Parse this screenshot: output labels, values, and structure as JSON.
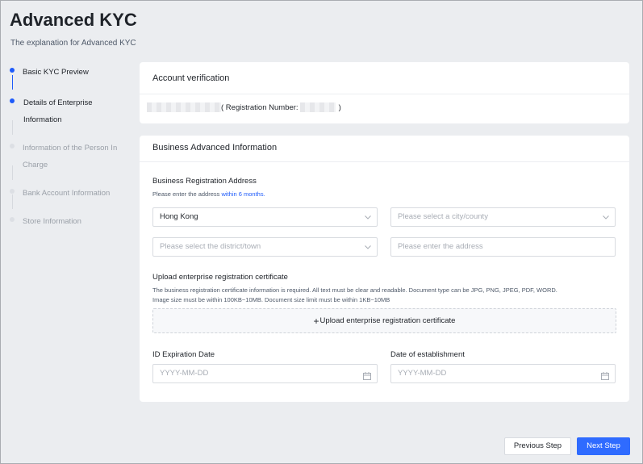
{
  "page": {
    "title": "Advanced KYC",
    "subtitle": "The explanation for Advanced KYC"
  },
  "steps": [
    {
      "label": "Basic KYC Preview",
      "state": "done"
    },
    {
      "label": "Details of Enterprise Information",
      "line1": "Details of Enterprise",
      "line2": "Information",
      "state": "active"
    },
    {
      "label": "Information of the Person In Charge",
      "line1": "Information of the Person In",
      "line2": "Charge",
      "state": "pending"
    },
    {
      "label": "Bank Account Information",
      "state": "pending"
    },
    {
      "label": "Store Information",
      "state": "pending"
    }
  ],
  "account": {
    "heading": "Account verification",
    "registration_open": "( Registration Number:",
    "registration_close": ")"
  },
  "business": {
    "heading": "Business Advanced Information",
    "address_label": "Business Registration Address",
    "address_hint_prefix": "Please enter the address ",
    "address_hint_link": "within 6 months.",
    "region_value": "Hong Kong",
    "city_placeholder": "Please select a city/county",
    "district_placeholder": "Please select the district/town",
    "address_placeholder": "Please enter the address",
    "upload_label": "Upload enterprise registration certificate",
    "upload_hint_line1": "The business registration certificate information is required. All text must be clear and readable. Document type can be JPG, PNG, JPEG, PDF, WORD.",
    "upload_hint_line2": "Image size must be within 100KB~10MB. Document size limit must be within 1KB~10MB",
    "upload_plus": "+",
    "upload_button": "Upload enterprise registration certificate",
    "id_expiration_label": "ID Expiration Date",
    "id_expiration_placeholder": "YYYY-MM-DD",
    "establishment_label": "Date of establishment",
    "establishment_placeholder": "YYYY-MM-DD"
  },
  "footer": {
    "prev_label": "Previous Step",
    "next_label": "Next Step"
  },
  "colors": {
    "accent": "#2f6bff",
    "background": "#ebedf0"
  },
  "icons": {
    "select_arrow": "chevron-down-icon",
    "date_picker": "calendar-icon"
  }
}
